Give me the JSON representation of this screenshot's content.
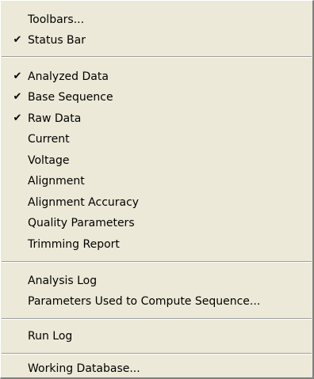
{
  "menu": {
    "items": [
      {
        "label": "Toolbars...",
        "checked": false
      },
      {
        "label": "Status Bar",
        "checked": true
      },
      {
        "label": "Analyzed Data",
        "checked": true
      },
      {
        "label": "Base Sequence",
        "checked": true
      },
      {
        "label": "Raw Data",
        "checked": true
      },
      {
        "label": "Current",
        "checked": false
      },
      {
        "label": "Voltage",
        "checked": false
      },
      {
        "label": "Alignment",
        "checked": false
      },
      {
        "label": "Alignment Accuracy",
        "checked": false
      },
      {
        "label": "Quality Parameters",
        "checked": false
      },
      {
        "label": "Trimming Report",
        "checked": false
      },
      {
        "label": "Analysis Log",
        "checked": false
      },
      {
        "label": "Parameters Used to Compute Sequence...",
        "checked": false
      },
      {
        "label": "Run Log",
        "checked": false
      },
      {
        "label": "Working Database...",
        "checked": false
      }
    ],
    "check_glyph": "✔",
    "check_icon": "checkmark-icon",
    "colors": {
      "background": "#ece9d8",
      "text": "#000000",
      "separator_dark": "#9d9d9d",
      "separator_light": "#ffffff"
    }
  }
}
